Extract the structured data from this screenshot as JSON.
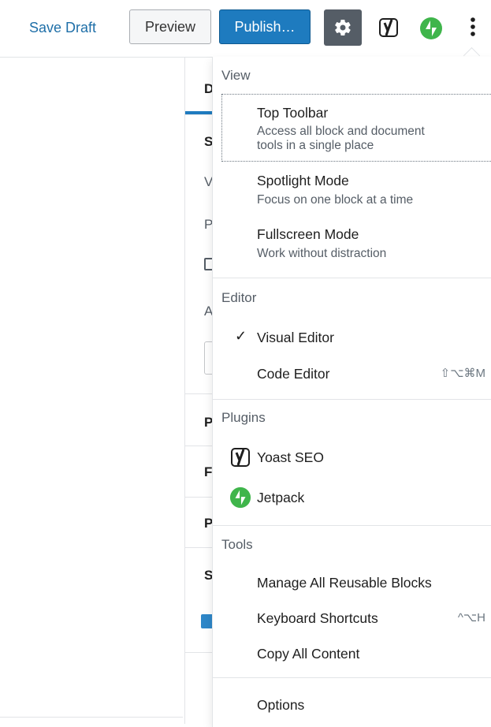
{
  "header": {
    "save_draft": "Save Draft",
    "preview": "Preview",
    "publish": "Publish…",
    "icons": [
      "gear-icon",
      "yoast-icon",
      "jetpack-icon",
      "more-vertical-icon"
    ]
  },
  "sidebar": {
    "tab_partial": "D",
    "rows": [
      "S",
      "V",
      "P",
      "A",
      "P",
      "F",
      "P",
      "S"
    ]
  },
  "menu": {
    "view": {
      "label": "View",
      "items": [
        {
          "title": "Top Toolbar",
          "desc_line1": "Access all block and document",
          "desc_line2": "tools in a single place"
        },
        {
          "title": "Spotlight Mode",
          "desc": "Focus on one block at a time"
        },
        {
          "title": "Fullscreen Mode",
          "desc": "Work without distraction"
        }
      ]
    },
    "editor": {
      "label": "Editor",
      "visual": "Visual Editor",
      "code": "Code Editor",
      "code_shortcut": "⇧⌥⌘M",
      "checkmark": "✓"
    },
    "plugins": {
      "label": "Plugins",
      "yoast": "Yoast SEO",
      "jetpack": "Jetpack"
    },
    "tools": {
      "label": "Tools",
      "reusable": "Manage All Reusable Blocks",
      "shortcuts": "Keyboard Shortcuts",
      "shortcuts_key": "^⌥H",
      "copy": "Copy All Content"
    },
    "options": "Options"
  },
  "colors": {
    "accent": "#1e7bbf",
    "jetpack": "#3fb54b",
    "settings_bg": "#555d66"
  }
}
